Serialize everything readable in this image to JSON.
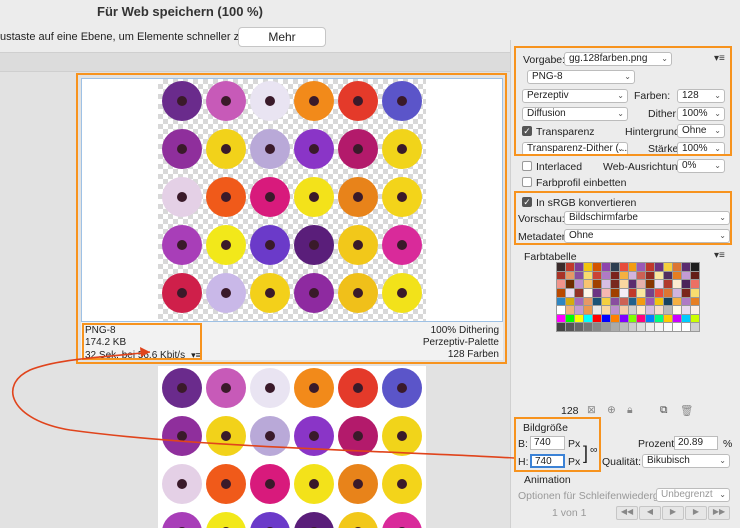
{
  "window": {
    "title": "Für Web speichern (100 %)"
  },
  "topbar": {
    "hint": "ustaste auf eine Ebene, um Elemente schneller zu exportieren",
    "more_label": "Mehr"
  },
  "preview": {
    "format": "PNG-8",
    "size": "174.2 KB",
    "time": "32 Sek. bei 56,6 Kbit/s",
    "dithering": "100% Dithering",
    "palette": "Perzeptiv-Palette",
    "colors": "128 Farben"
  },
  "settings": {
    "preset_label": "Vorgabe:",
    "preset_value": "gg.128farben.png",
    "format_value": "PNG-8",
    "reduction_value": "Perzeptiv",
    "colors_label": "Farben:",
    "colors_value": "128",
    "dither_method": "Diffusion",
    "dither_label": "Dither:",
    "dither_value": "100%",
    "transparency_label": "Transparenz",
    "matte_label": "Hintergrund:",
    "matte_value": "Ohne",
    "transparency_dither": "Transparenz-Dither (...",
    "amount_label": "Stärke:",
    "amount_value": "100%",
    "interlaced_label": "Interlaced",
    "web_snap_label": "Web-Ausrichtung:",
    "web_snap_value": "0%",
    "embed_profile_label": "Farbprofil einbetten",
    "srgb_label": "In sRGB konvertieren",
    "preview_label": "Vorschau:",
    "preview_value": "Bildschirmfarbe",
    "metadata_label": "Metadaten:",
    "metadata_value": "Ohne"
  },
  "color_table": {
    "title": "Farbtabelle",
    "count": "128",
    "colors": [
      "#3a2a2a",
      "#c0392b",
      "#7d3c98",
      "#f1c40f",
      "#d35400",
      "#8e44ad",
      "#2c3e50",
      "#e74c3c",
      "#f39c12",
      "#9b59b6",
      "#c0392b",
      "#6c3483",
      "#f4d03f",
      "#dc7633",
      "#5b2c6f",
      "#1f1f1f",
      "#a93226",
      "#e59866",
      "#884ea0",
      "#f7dc6f",
      "#cb4335",
      "#af7ac5",
      "#7b241c",
      "#f5b041",
      "#d2b4de",
      "#cd6155",
      "#922b21",
      "#f9e79f",
      "#512e5f",
      "#e67e22",
      "#c39bd3",
      "#641e16",
      "#f1948a",
      "#6e2c00",
      "#bb8fce",
      "#f8c471",
      "#a04000",
      "#d7bde2",
      "#78281f",
      "#fad7a0",
      "#5b2c6f",
      "#e6b0aa",
      "#873600",
      "#e8daef",
      "#b03a2e",
      "#fdebd0",
      "#4a235a",
      "#ec7063",
      "#ba4a00",
      "#ebdef0",
      "#943126",
      "#fef5e7",
      "#6c3483",
      "#f5b7b1",
      "#a04000",
      "#f4ecf7",
      "#c0392b",
      "#f9e79f",
      "#76448a",
      "#e74c3c",
      "#dc7633",
      "#d2b4de",
      "#7b241c",
      "#f7dc6f",
      "#2e86c1",
      "#d4ac0d",
      "#a569bd",
      "#e59866",
      "#1a5276",
      "#f4d03f",
      "#884ea0",
      "#cd6155",
      "#21618c",
      "#f39c12",
      "#9b59b6",
      "#f1c40f",
      "#154360",
      "#f5b041",
      "#af7ac5",
      "#e67e22",
      "#ffffff",
      "#f0b27a",
      "#c39bd3",
      "#eb984e",
      "#e8e8e8",
      "#fad7a0",
      "#bb8fce",
      "#f5cba7",
      "#d0d0d0",
      "#fdebd0",
      "#d7bde2",
      "#f6ddcc",
      "#b8b8b8",
      "#fef9e7",
      "#e8daef",
      "#fbeee6",
      "#ff00ff",
      "#00ff00",
      "#ffff00",
      "#00ffff",
      "#ff0000",
      "#0000ff",
      "#ff8000",
      "#8000ff",
      "#80ff00",
      "#ff0080",
      "#0080ff",
      "#00ff80",
      "#ffcc00",
      "#cc00ff",
      "#00ccff",
      "#ccff00",
      "#444444",
      "#555555",
      "#666666",
      "#777777",
      "#888888",
      "#999999",
      "#aaaaaa",
      "#bbbbbb",
      "#cccccc",
      "#dddddd",
      "#eeeeee",
      "#f5f5f5",
      "#fafafa",
      "#fdfdfd",
      "#ffffff",
      "#cfcfcf"
    ]
  },
  "image_size": {
    "title": "Bildgröße",
    "width_label": "B:",
    "width_value": "740",
    "height_label": "H:",
    "height_value": "740",
    "unit": "Px",
    "percent_label": "Prozent:",
    "percent_value": "20.89",
    "percent_unit": "%",
    "quality_label": "Qualität:",
    "quality_value": "Bikubisch"
  },
  "animation": {
    "title": "Animation",
    "loop_label": "Optionen für Schleifenwiedergabe:",
    "loop_value": "Unbegrenzt",
    "frame_label": "1 von 1"
  },
  "flower_colors": [
    "#6a2b8c",
    "#c75ab8",
    "#e9e4f2",
    "#f28a1a",
    "#e43a2a",
    "#5b55c9",
    "#8f2f9c",
    "#f2d21a",
    "#b9a9d8",
    "#8a35c7",
    "#b31a6b",
    "#f1d41a",
    "#e4d0e6",
    "#f05a1a",
    "#d81a7c",
    "#f3e21a",
    "#e8831a",
    "#f3d41a",
    "#a83eb8",
    "#f2e81a",
    "#6b3ac9",
    "#5a1e7a",
    "#f2c81a",
    "#d92a9a",
    "#cf1f4a",
    "#c9b8e8",
    "#f3d01a",
    "#8e2aa0",
    "#f0c01a",
    "#f2e21a",
    "#d43a9a",
    "#f2d41a",
    "#8e52c9",
    "#f2c81a",
    "#a42a7a",
    "#f2d21a"
  ]
}
